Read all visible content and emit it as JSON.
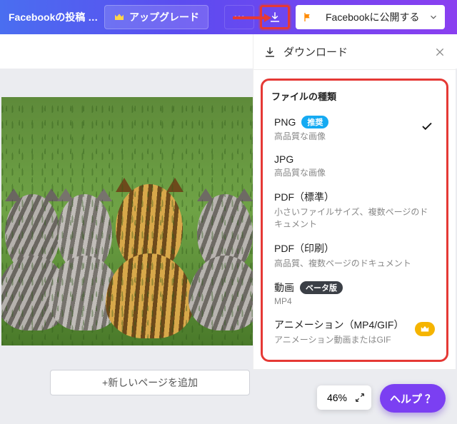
{
  "header": {
    "title": "Facebookの投稿 -...",
    "upgrade_label": "アップグレード",
    "publish_label": "Facebookに公開する"
  },
  "download": {
    "header": "ダウンロード",
    "section_title": "ファイルの種類",
    "options": [
      {
        "name": "PNG",
        "badge": "推奨",
        "badge_kind": "rec",
        "desc": "高品質な画像",
        "selected": true
      },
      {
        "name": "JPG",
        "desc": "高品質な画像"
      },
      {
        "name": "PDF（標準）",
        "desc": "小さいファイルサイズ、複数ページのドキュメント"
      },
      {
        "name": "PDF（印刷）",
        "desc": "高品質、複数ページのドキュメント"
      },
      {
        "name": "動画",
        "badge": "ベータ版",
        "badge_kind": "beta",
        "desc": "MP4"
      },
      {
        "name": "アニメーション（MP4/GIF）",
        "desc": "アニメーション動画またはGIF",
        "premium": true
      }
    ]
  },
  "canvas": {
    "add_page_label": "+新しいページを追加"
  },
  "footer": {
    "zoom_label": "46%",
    "help_label": "ヘルプ",
    "help_q": "？"
  }
}
